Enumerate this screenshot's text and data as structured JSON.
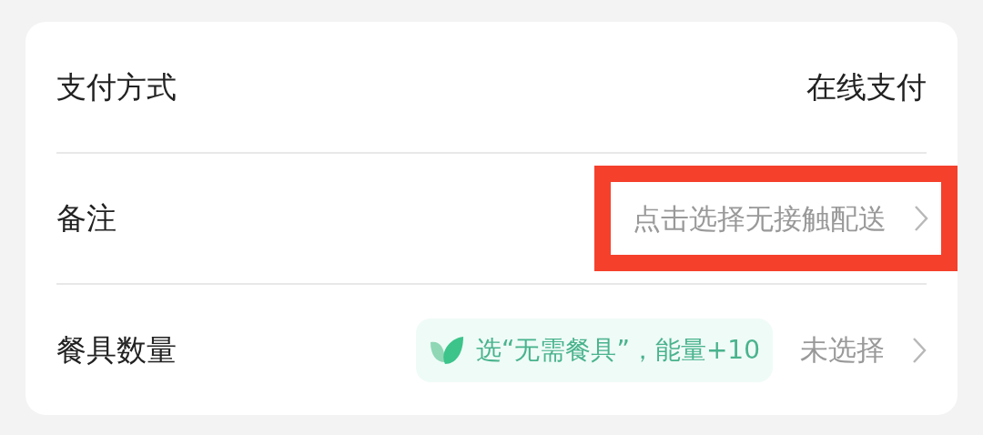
{
  "rows": [
    {
      "kind": "plain",
      "label": "支付方式",
      "value": "在线支付",
      "highlighted": false
    },
    {
      "kind": "link",
      "label": "备注",
      "value": "点击选择无接触配送",
      "highlighted": true
    },
    {
      "kind": "tableware",
      "label": "餐具数量",
      "badge": "选“无需餐具”，能量+10",
      "value": "未选择",
      "highlighted": false
    }
  ]
}
